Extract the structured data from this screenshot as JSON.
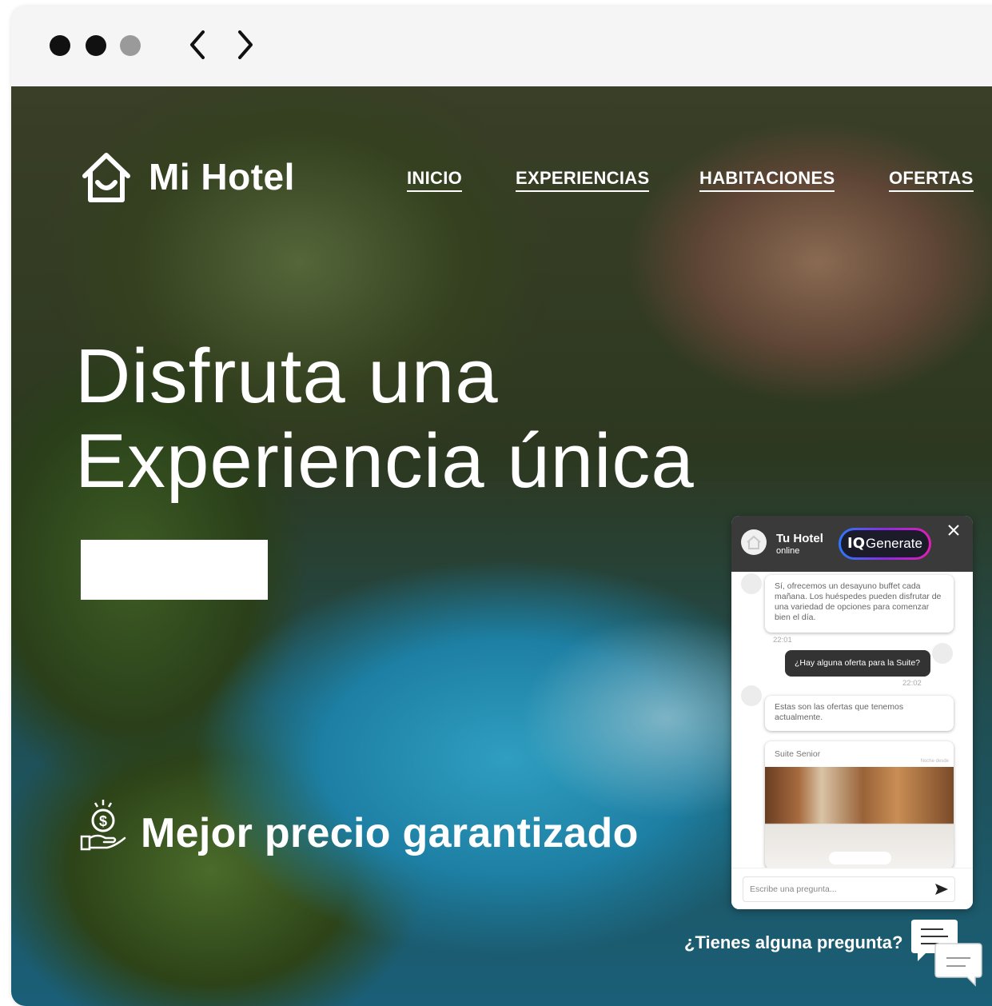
{
  "app": {
    "window_controls": [
      "close",
      "minimize",
      "maximize"
    ],
    "back_icon": "chevron-left-icon",
    "forward_icon": "chevron-right-icon"
  },
  "site": {
    "logo_icon": "house-smile-icon",
    "brand": "Mi Hotel",
    "nav": [
      "INICIO",
      "EXPERIENCIAS",
      "HABITACIONES",
      "OFERTAS"
    ],
    "headline_line1": "Disfruta una",
    "headline_line2": "Experiencia única",
    "cta_label": "",
    "guarantee_icon": "money-hand-icon",
    "guarantee": "Mejor precio garantizado",
    "question_prompt": "¿Tienes alguna pregunta?",
    "chat_launcher_icon": "chat-bubbles-icon"
  },
  "chat": {
    "name": "Tu Hotel",
    "status": "online",
    "badge_mark": "IQ",
    "badge_text": "Generate",
    "close_icon": "close-icon",
    "messages": [
      {
        "from": "bot",
        "text": "Sí, ofrecemos un desayuno buffet cada mañana. Los huéspedes pueden disfrutar de una variedad de opciones para comenzar bien el día.",
        "time": "22:01"
      },
      {
        "from": "user",
        "text": "¿Hay alguna oferta para la Suite?",
        "time": "22:02"
      },
      {
        "from": "bot",
        "text": "Estas son las ofertas que tenemos actualmente.",
        "time": ""
      }
    ],
    "offer_card": {
      "title": "Suite Senior",
      "subtitle": "Noche desde"
    },
    "input_placeholder": "Escribe una pregunta...",
    "send_icon": "send-icon"
  },
  "colors": {
    "window_bg": "#f5f5f5",
    "chat_header": "#3a3a3a",
    "user_bubble": "#333333",
    "badge_gradient": [
      "#2a7bff",
      "#8a2be2",
      "#e11eb5"
    ]
  }
}
